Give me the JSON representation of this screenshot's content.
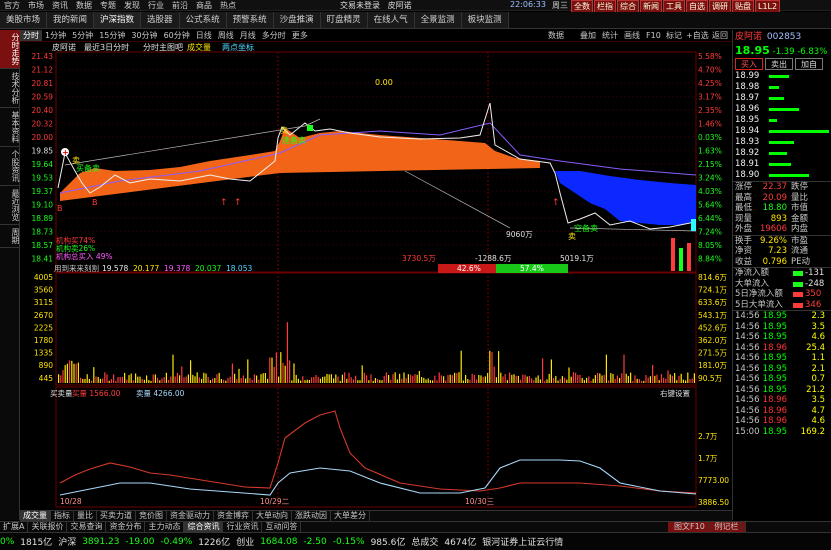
{
  "menubar": {
    "items": [
      "官方",
      "市场",
      "资讯",
      "数据",
      "专题",
      "发现",
      "行业",
      "前沿",
      "商品",
      "热点"
    ],
    "title": "交易未登录",
    "stock_name": "皮阿诺",
    "clock": "22:06:33",
    "weekday": "周三",
    "buttons": [
      "全数",
      "栏指",
      "综合",
      "新闻",
      "工具",
      "自选",
      "调研",
      "贴盘",
      "L1L2"
    ]
  },
  "tabbar": {
    "tabs": [
      "美股市场",
      "我的新闻",
      "沪深指数",
      "选股器",
      "公式系统",
      "预警系统",
      "沙盘推演",
      "盯盘精灵",
      "在线人气",
      "全景监测",
      "板块监测"
    ],
    "active_index": 2
  },
  "leftbar": {
    "tabs": [
      "分时走势",
      "技术分析",
      "基本资料",
      "个股资讯",
      "最近浏览",
      "周期"
    ],
    "active_index": 0
  },
  "periodbar": {
    "items": [
      "分时",
      "1分钟",
      "5分钟",
      "15分钟",
      "30分钟",
      "60分钟",
      "日线",
      "周线",
      "月线",
      "多分时",
      "更多"
    ],
    "active_index": 0,
    "right_items": [
      "数据",
      "叠加",
      "统计",
      "画线",
      "F10",
      "标记",
      "+自选",
      "返回"
    ]
  },
  "chart": {
    "legend": {
      "stock_name": "皮阿诺",
      "tag1": "最近3日分时",
      "tag2": "分时主图吧",
      "tag3": "成交量",
      "tag4": "两点坐标"
    },
    "price_axis_left": [
      "21.43",
      "21.12",
      "20.81",
      "20.59",
      "20.40",
      "20.32",
      "20.00",
      "19.85",
      "19.64",
      "19.53",
      "19.37",
      "19.10",
      "18.89",
      "18.73",
      "18.57",
      "18.41"
    ],
    "price_axis_right": [
      "5.58%",
      "4.70%",
      "4.25%",
      "3.17%",
      "2.35%",
      "1.46%",
      "0.03%",
      "1.63%",
      "2.15%",
      "3.24%",
      "4.03%",
      "5.64%",
      "6.44%",
      "7.24%",
      "8.05%",
      "8.84%"
    ],
    "volume_axis_left": [
      "4005",
      "3560",
      "3115",
      "2670",
      "2225",
      "1780",
      "1335",
      "890",
      "445"
    ],
    "volume_axis_right": [
      "814.6万",
      "724.1万",
      "633.6万",
      "543.1万",
      "452.6万",
      "362.0万",
      "271.5万",
      "181.0万",
      "90.5万"
    ],
    "flow_axis_right": [
      "2.7万",
      "1.7万",
      "7773.00",
      "3886.50",
      "00"
    ],
    "dates": [
      "10/28",
      "10/29二",
      "10/30三"
    ],
    "zero_label": "0.00",
    "ma_line": {
      "label": "用到来来刻割",
      "values": [
        "19.578",
        "20.177",
        "19.378",
        "20.037",
        "18.053"
      ]
    },
    "mid_labels": {
      "v1": "3730.5万",
      "v2": "-1288.6万",
      "v3": "5019.1万",
      "v4": "9060万",
      "pct_red": "42.6%",
      "pct_green": "57.4%"
    },
    "tags": {
      "buy1": "卖",
      "buy2": "卖",
      "buy3": "卖",
      "sell1": "买备卖",
      "sell2": "逢备卖",
      "sell3": "空备卖",
      "b1": "B",
      "b2": "B"
    },
    "inst_labels": {
      "l1": "机构买74%",
      "l2": "机构卖26%",
      "l3": "机构总买入 49%"
    },
    "flow_legend": {
      "label1": "买卖量",
      "label2": "买量",
      "v2": "1566.00",
      "label3": "卖量",
      "v3": "4266.00",
      "right_label": "右键设置"
    },
    "colors": {
      "up": "#ff3b3b",
      "down": "#1aff1a",
      "orange_fill": "#ff6a1a",
      "blue_fill": "#0a28ff",
      "flow_red": "#d23a2a",
      "flow_blue": "#a8d8f8"
    }
  },
  "rightpanel": {
    "name": "皮阿诺",
    "code": "002853",
    "price": "18.95",
    "change": "-1.39",
    "change_pct": "-6.83%",
    "buttons": [
      "买入",
      "卖出",
      "加自"
    ],
    "orderbook": [
      {
        "p": "18.99",
        "w": 20
      },
      {
        "p": "18.98",
        "w": 10
      },
      {
        "p": "18.97",
        "w": 15
      },
      {
        "p": "18.96",
        "w": 30
      },
      {
        "p": "18.95",
        "w": 8
      },
      {
        "p": "18.94",
        "w": 60
      },
      {
        "p": "18.93",
        "w": 25
      },
      {
        "p": "18.92",
        "w": 18
      },
      {
        "p": "18.91",
        "w": 22
      },
      {
        "p": "18.90",
        "w": 40
      }
    ],
    "stats": [
      {
        "k": "涨停",
        "v": "22.37",
        "vc": "red",
        "k2": "跌停",
        "v2": ""
      },
      {
        "k": "最高",
        "v": "20.09",
        "vc": "red",
        "k2": "量比",
        "v2": ""
      },
      {
        "k": "最低",
        "v": "18.80",
        "vc": "grn",
        "k2": "市值",
        "v2": ""
      },
      {
        "k": "现量",
        "v": "893",
        "vc": "yel",
        "k2": "金额",
        "v2": ""
      },
      {
        "k": "外盘",
        "v": "19606",
        "vc": "red",
        "k2": "内盘",
        "v2": ""
      }
    ],
    "ratios": [
      {
        "k": "换手",
        "v": "9.26%",
        "k2": "市盈"
      },
      {
        "k": "净资",
        "v": "7.23",
        "k2": "流通"
      },
      {
        "k": "收益",
        "v": "0.796",
        "k2": "PE动"
      }
    ],
    "flows": [
      {
        "k": "净流入额",
        "v": "-131"
      },
      {
        "k": "大单流入",
        "v": "-248"
      },
      {
        "k": "5日净流入额",
        "v": "350"
      },
      {
        "k": "5日大单流入",
        "v": "346"
      }
    ],
    "ticks": [
      {
        "t": "14:56",
        "p": "18.95",
        "q": "2.3",
        "up": false
      },
      {
        "t": "14:56",
        "p": "18.95",
        "q": "3.5",
        "up": false
      },
      {
        "t": "14:56",
        "p": "18.95",
        "q": "4.6",
        "up": false
      },
      {
        "t": "14:56",
        "p": "18.96",
        "q": "25.4",
        "up": true
      },
      {
        "t": "14:56",
        "p": "18.95",
        "q": "1.1",
        "up": false
      },
      {
        "t": "14:56",
        "p": "18.95",
        "q": "2.1",
        "up": false
      },
      {
        "t": "14:56",
        "p": "18.95",
        "q": "0.7",
        "up": false
      },
      {
        "t": "14:56",
        "p": "18.95",
        "q": "21.2",
        "up": false
      },
      {
        "t": "14:56",
        "p": "18.96",
        "q": "3.5",
        "up": true
      },
      {
        "t": "14:56",
        "p": "18.96",
        "q": "4.7",
        "up": true
      },
      {
        "t": "14:56",
        "p": "18.96",
        "q": "4.6",
        "up": true
      },
      {
        "t": "15:00",
        "p": "18.95",
        "q": "169.2",
        "up": false
      }
    ]
  },
  "subtabs": {
    "items": [
      "成交量",
      "指标",
      "量比",
      "买卖力道",
      "竞价图",
      "资金驱动力",
      "资金博弈",
      "大单动向",
      "涨跌动因",
      "大单差分"
    ],
    "active_index": 0
  },
  "bottomtabs": {
    "items": [
      "扩展A",
      "关联报价",
      "交易查询",
      "资金分布",
      "主力动态",
      "综合资讯",
      "行业资讯",
      "互动问答"
    ],
    "active_index": 5,
    "right_label": "图文F10",
    "right_label2": "例记栏"
  },
  "statusbar": {
    "items": [
      {
        "t": "0%",
        "c": "grn"
      },
      {
        "t": "1815亿",
        "c": "wht"
      },
      {
        "t": "沪深",
        "c": "wht"
      },
      {
        "t": "3891.23",
        "c": "grn"
      },
      {
        "t": "-19.00",
        "c": "grn"
      },
      {
        "t": "-0.49%",
        "c": "grn"
      },
      {
        "t": "1226亿",
        "c": "wht"
      },
      {
        "t": "创业",
        "c": "wht"
      },
      {
        "t": "1684.08",
        "c": "grn"
      },
      {
        "t": "-2.50",
        "c": "grn"
      },
      {
        "t": "-0.15%",
        "c": "grn"
      },
      {
        "t": "985.6亿",
        "c": "wht"
      },
      {
        "t": "总成交",
        "c": "wht"
      },
      {
        "t": "4674亿",
        "c": "wht"
      },
      {
        "t": "银河证券上证云行情",
        "c": "wht"
      }
    ]
  }
}
